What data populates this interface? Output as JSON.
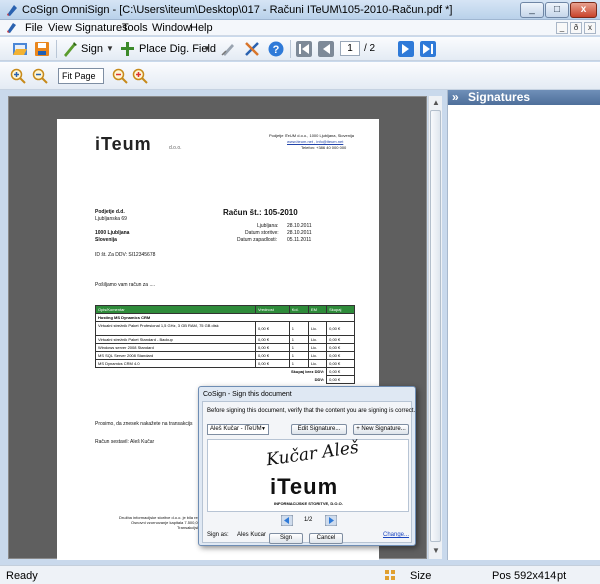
{
  "window": {
    "title": "CoSign OmniSign - [C:\\Users\\iteum\\Desktop\\017 - Računi ITeUM\\105-2010-Račun.pdf *]",
    "minimize": "_",
    "maximize": "□",
    "close": "x"
  },
  "menu": {
    "items": [
      "File",
      "View",
      "Signatures",
      "Tools",
      "Window",
      "Help"
    ],
    "mdi_min": "_",
    "mdi_restore": "ð",
    "mdi_close": "x"
  },
  "toolbar": {
    "sign_label": "Sign",
    "place_field_label": "Place Dig. Field",
    "page_current": "1",
    "page_total": "/ 2",
    "zoom_value": "Fit Page"
  },
  "side_panel": {
    "title": "Signatures",
    "chevron": "»"
  },
  "status": {
    "ready": "Ready",
    "size_label": "Size",
    "pos": "Pos  592x414",
    "unit": "pt"
  },
  "document": {
    "logo": "iTeum",
    "logo_suffix": "d.o.o.",
    "company_addr": "Podjetje ITeUM d.o.o., 1000 Ljubljana, Slovenija",
    "company_web": "www.iteum.net , info@iteum.net",
    "company_phone": "Telefon: +386 40 000 000",
    "customer_name": "Podjetje d.d.",
    "customer_street": "Ljubljanska 69",
    "customer_city": "1000 Ljubljana",
    "customer_country": "Slovenija",
    "customer_vat": "ID št. Za DDV: SI12345678",
    "invoice_title": "Račun št.: 105-2010",
    "place_label": "Ljubljana:",
    "place_date": "28.10.2011",
    "service_label": "Datum storitve:",
    "service_date": "28.10.2011",
    "due_label": "Datum zapadlosti:",
    "due_date": "05.11.2011",
    "intro": "Pošiljamo vam račun za ....",
    "table_headers": [
      "Opis/Komentar",
      "Vrednost",
      "Kol.",
      "EM",
      "Skupaj"
    ],
    "group_row": "Hosting MS Dynamics CRM",
    "rows": [
      [
        "Virtualni strežnik Paket Profesional 1,5 GHz, 3 GB RAM, 75 GB disk",
        "0,00 €",
        "1",
        "Lic.",
        "0,00 €"
      ],
      [
        "Virtualni strežnik Paket Standard - Backup",
        "0,00 €",
        "1",
        "Lic.",
        "0,00 €"
      ],
      [
        "Windows server 2008 Standard",
        "0,00 €",
        "1",
        "Lic.",
        "0,00 €"
      ],
      [
        "MS SQL Server 2008 Standard",
        "0,00 €",
        "1",
        "Lic.",
        "0,00 €"
      ],
      [
        "MS Dynamics CRM 4.0",
        "0,00 €",
        "1",
        "Lic.",
        "0,00 €"
      ]
    ],
    "subtotal_label": "Skupaj brez DDV:",
    "subtotal_value": "0,00 €",
    "vat_label": "DDV:",
    "vat_value": "0,00 €",
    "payment_note": "Prosimo, da znesek nakažete na transakcijs",
    "author": "Račun sestavil:  Aleš Kučar",
    "footer1": "Družba informacijske storitve d.o.o. je bila registr",
    "footer2": "Osnovni vzornovanje kapitala 7.500,00",
    "footer3": "Transakcijski"
  },
  "dialog": {
    "title": "CoSign - Sign this document",
    "instruction": "Before signing this document, verify that the content you are signing is correct.",
    "signer_value": "Aleš Kučar - ITeUM",
    "edit_button": "Edit Signature...",
    "new_button": "+ New Signature...",
    "signature_script": "Kučar Aleš",
    "sig_logo": "iTeum",
    "sig_subtitle": "INFORMACIJSKE STORITVE, D.O.O.",
    "pager": "1/2",
    "sign_as_label": "Sign as:",
    "sign_as_value": "Ales Kucar",
    "change_link": "Change...",
    "sign_button": "Sign",
    "cancel_button": "Cancel"
  }
}
